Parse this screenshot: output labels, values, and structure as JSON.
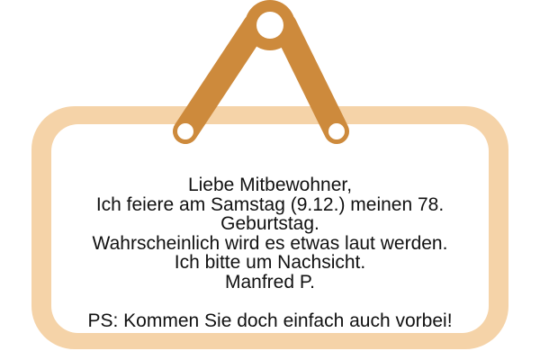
{
  "sign": {
    "frame_color": "#f5d3a8",
    "hanger_color": "#cd8a3c",
    "background_color": "#ffffff",
    "text_color": "#111111",
    "lines": [
      "Liebe Mitbewohner,",
      "Ich feiere am Samstag (9.12.) meinen 78.",
      "Geburtstag.",
      "Wahrscheinlich wird es etwas laut werden.",
      "Ich bitte um Nachsicht.",
      "Manfred P."
    ],
    "postscript": "PS: Kommen Sie doch einfach auch vorbei!"
  }
}
